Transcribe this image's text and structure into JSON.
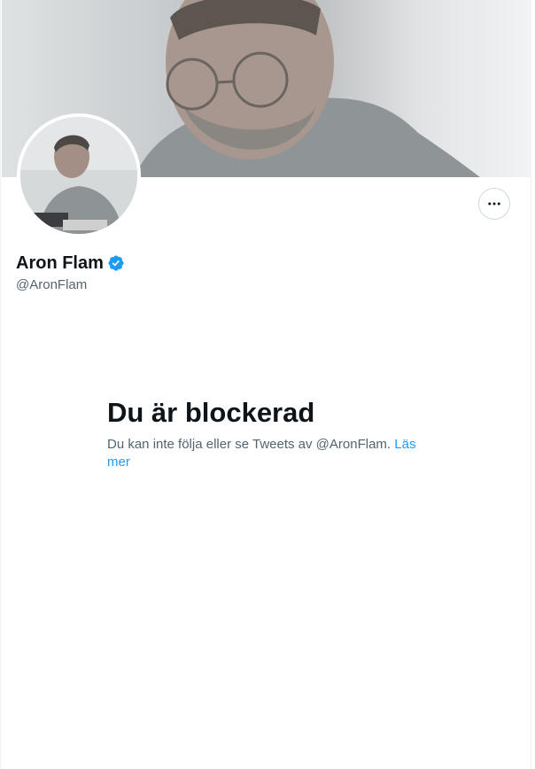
{
  "profile": {
    "display_name": "Aron Flam",
    "handle": "@AronFlam",
    "verified": true,
    "verified_color": "#1d9bf0"
  },
  "blocked": {
    "title": "Du är blockerad",
    "message": "Du kan inte följa eller se Tweets av @AronFlam.",
    "link_label": "Läs mer",
    "link_color": "#1d9bf0"
  },
  "icons": {
    "more": "more-horizontal-icon",
    "verified": "verified-badge-icon"
  }
}
